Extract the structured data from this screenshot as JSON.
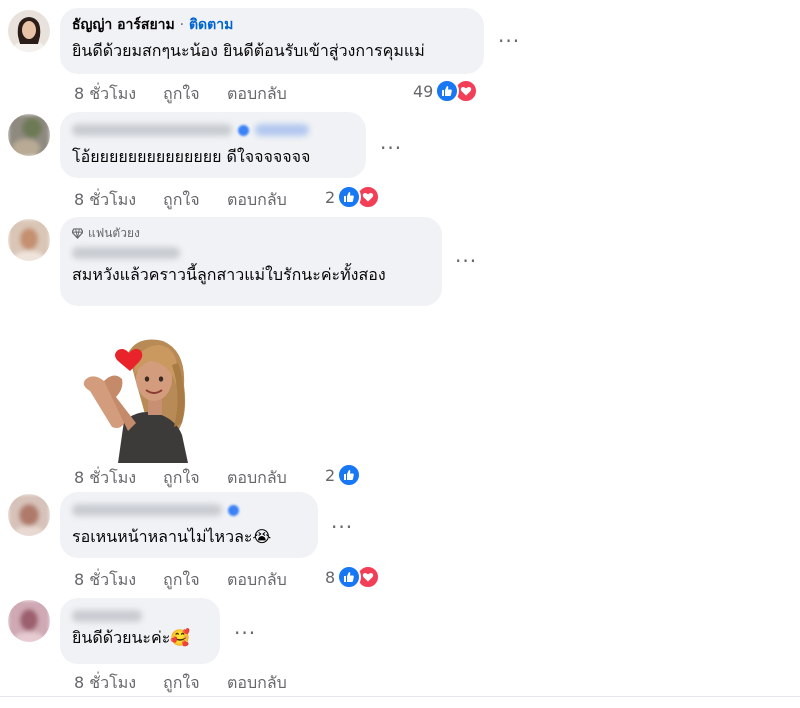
{
  "comments": [
    {
      "author": "ธัญญ่า อาร์สยาม",
      "separator": "·",
      "follow_label": "ติดตาม",
      "text": "ยินดีด้วยมสกๆนะน้อง ยินดีต้อนรับเข้าสู่วงการคุมแม่",
      "time": "8 ชั่วโมง",
      "like_label": "ถูกใจ",
      "reply_label": "ตอบกลับ",
      "reaction_count": "49",
      "reactions": [
        "like-icon",
        "love-icon"
      ]
    },
    {
      "author": "",
      "text": "โอ้ยยยยยยยยยยยยยย ดีใจจจจจจจ",
      "time": "8 ชั่วโมง",
      "like_label": "ถูกใจ",
      "reply_label": "ตอบกลับ",
      "reaction_count": "2",
      "reactions": [
        "like-icon",
        "love-icon"
      ]
    },
    {
      "badge": "แฟนตัวยง",
      "author": "",
      "text": "สมหวังแล้วคราวนี้ลูกสาวแม่ใบรักนะค่ะทั้งสอง",
      "sticker": "heart-hands-avatar-sticker",
      "time": "8 ชั่วโมง",
      "like_label": "ถูกใจ",
      "reply_label": "ตอบกลับ",
      "reaction_count": "2",
      "reactions": [
        "like-icon"
      ]
    },
    {
      "author": "",
      "text": "รอเหนหน้าหลานไม่ไหวละ😭",
      "time": "8 ชั่วโมง",
      "like_label": "ถูกใจ",
      "reply_label": "ตอบกลับ",
      "reaction_count": "8",
      "reactions": [
        "like-icon",
        "love-icon"
      ]
    },
    {
      "author": "",
      "text": "ยินดีด้วยนะค่ะ🥰",
      "time": "8 ชั่วโมง",
      "like_label": "ถูกใจ",
      "reply_label": "ตอบกลับ",
      "reaction_count": "",
      "reactions": []
    }
  ],
  "more_label": "···",
  "colors": {
    "like": "#1877f2",
    "love": "#f33e58",
    "link": "#0064d1",
    "bubble": "#f0f2f5",
    "meta": "#65676b"
  }
}
